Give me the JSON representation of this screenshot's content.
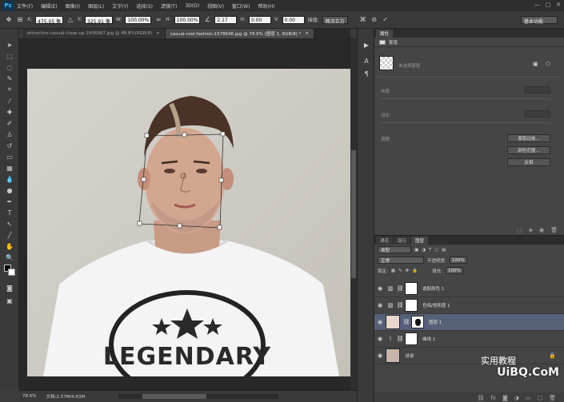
{
  "app": {
    "logo": "Ps"
  },
  "menu": [
    "文件(F)",
    "编辑(E)",
    "图像(I)",
    "图层(L)",
    "文字(Y)",
    "选择(S)",
    "滤镜(T)",
    "3D(D)",
    "视图(V)",
    "窗口(W)",
    "帮助(H)"
  ],
  "window_controls": [
    "—",
    "□",
    "✕"
  ],
  "options": {
    "x_label": "X:",
    "x_value": "475.05 像",
    "y_label": "Y:",
    "y_value": "325.91 像",
    "w_label": "W:",
    "w_value": "100.00%",
    "h_label": "H:",
    "h_value": "100.00%",
    "angle_value": "2.17",
    "hskew_label": "H:",
    "hskew_value": "0.00",
    "vskew_label": "V:",
    "vskew_value": "0.00",
    "interp_label": "插值:",
    "interp_value": "两次立方",
    "workspace": "基本功能"
  },
  "tabs": [
    {
      "label": "attractive-casual-close-up-1906997.jpg @ 48.8%(RGB/8)",
      "close": "×"
    },
    {
      "label": "casual-cool-fashion-1578646.jpg @ 78.6% (图层 1, RGB/8) *",
      "close": "×"
    }
  ],
  "status": {
    "zoom": "78.6%",
    "doc": "文档:2.57M/4.63M"
  },
  "properties": {
    "tabs": [
      "属性"
    ],
    "sub_title": "蒙版",
    "mask_label": "未选择蒙版",
    "density_label": "浓度:",
    "feather_label": "羽化:",
    "adjust_label": "调整:",
    "buttons": [
      "蒙版边缘...",
      "颜色范围...",
      "反相"
    ]
  },
  "layers": {
    "tabs": [
      "通道",
      "路径",
      "图层"
    ],
    "filter_kind": "类型",
    "blend_mode": "正常",
    "opacity_label": "不透明度:",
    "opacity_value": "100%",
    "lock_label": "锁定:",
    "fill_label": "填充:",
    "fill_value": "100%",
    "items": [
      {
        "name": "选取颜色 1",
        "icon": "selective-color-icon"
      },
      {
        "name": "色相/饱和度 1",
        "icon": "hue-saturation-icon"
      },
      {
        "name": "图层 1",
        "icon": "layer-icon"
      },
      {
        "name": "曲线 1",
        "icon": "curves-icon"
      },
      {
        "name": "背景",
        "icon": "background-icon"
      }
    ]
  },
  "watermark": {
    "line1": "实用教程",
    "line2": "UiBQ.CoM"
  },
  "colors": {
    "panel": "#454545",
    "selected_layer": "#566179",
    "ps_blue": "#4bbcf5"
  }
}
